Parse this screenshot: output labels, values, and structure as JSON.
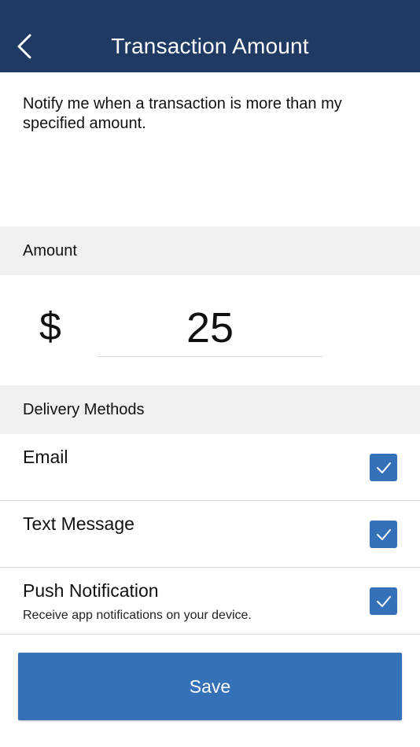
{
  "header": {
    "title": "Transaction Amount",
    "back_icon": "chevron-left-icon"
  },
  "description": "Notify me when a transaction is more than my specified amount.",
  "amount_section": {
    "label": "Amount",
    "currency_symbol": "$",
    "value": "25"
  },
  "delivery_section": {
    "label": "Delivery Methods",
    "methods": [
      {
        "label": "Email",
        "subtext": "",
        "checked": true
      },
      {
        "label": "Text Message",
        "subtext": "",
        "checked": true
      },
      {
        "label": "Push Notification",
        "subtext": "Receive app notifications on your device.",
        "checked": true
      }
    ]
  },
  "save_button": {
    "label": "Save"
  },
  "colors": {
    "header_bg": "#1f3a63",
    "accent": "#3571b8",
    "section_bg": "#f0f0f0"
  }
}
